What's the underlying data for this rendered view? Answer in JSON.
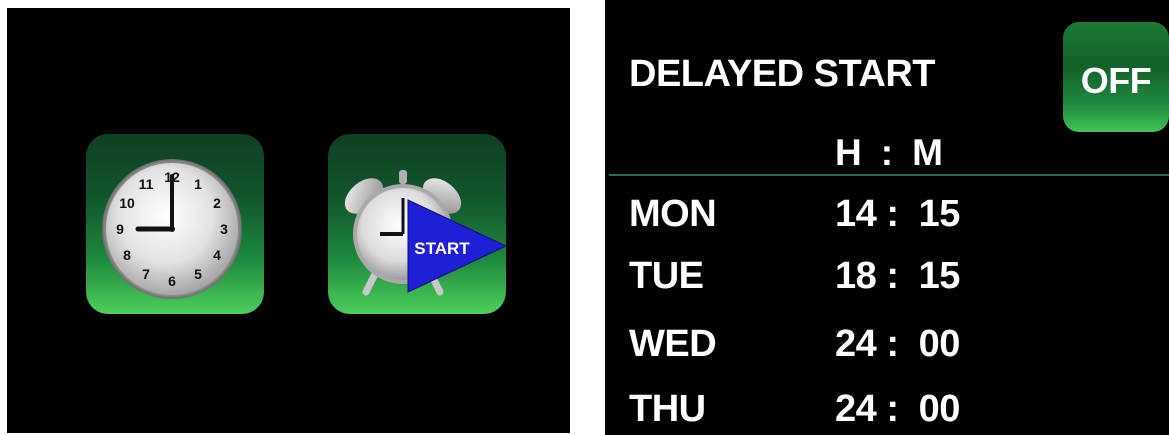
{
  "home_screen": {
    "apps": [
      {
        "name": "clock",
        "icon": "wall-clock-icon"
      },
      {
        "name": "delayed-start",
        "icon": "alarm-clock-start-icon",
        "badge_label": "START"
      }
    ],
    "clock_face": {
      "numbers": [
        "12",
        "1",
        "2",
        "3",
        "4",
        "5",
        "6",
        "7",
        "8",
        "9",
        "10",
        "11"
      ]
    }
  },
  "delayed_start": {
    "title": "DELAYED START",
    "toggle_label": "OFF",
    "column_header": "H  :  M",
    "schedule": [
      {
        "day": "MON",
        "time": "14 :  15"
      },
      {
        "day": "TUE",
        "time": "18 :  15"
      },
      {
        "day": "WED",
        "time": "24 :  00"
      },
      {
        "day": "THU",
        "time": "24 :  00"
      }
    ]
  },
  "colors": {
    "background": "#000000",
    "tile_green_dark": "#0f3f22",
    "tile_green_light": "#4fcf5c",
    "start_badge": "#1f1fd6",
    "text": "#ffffff",
    "divider": "#2f6b49"
  }
}
